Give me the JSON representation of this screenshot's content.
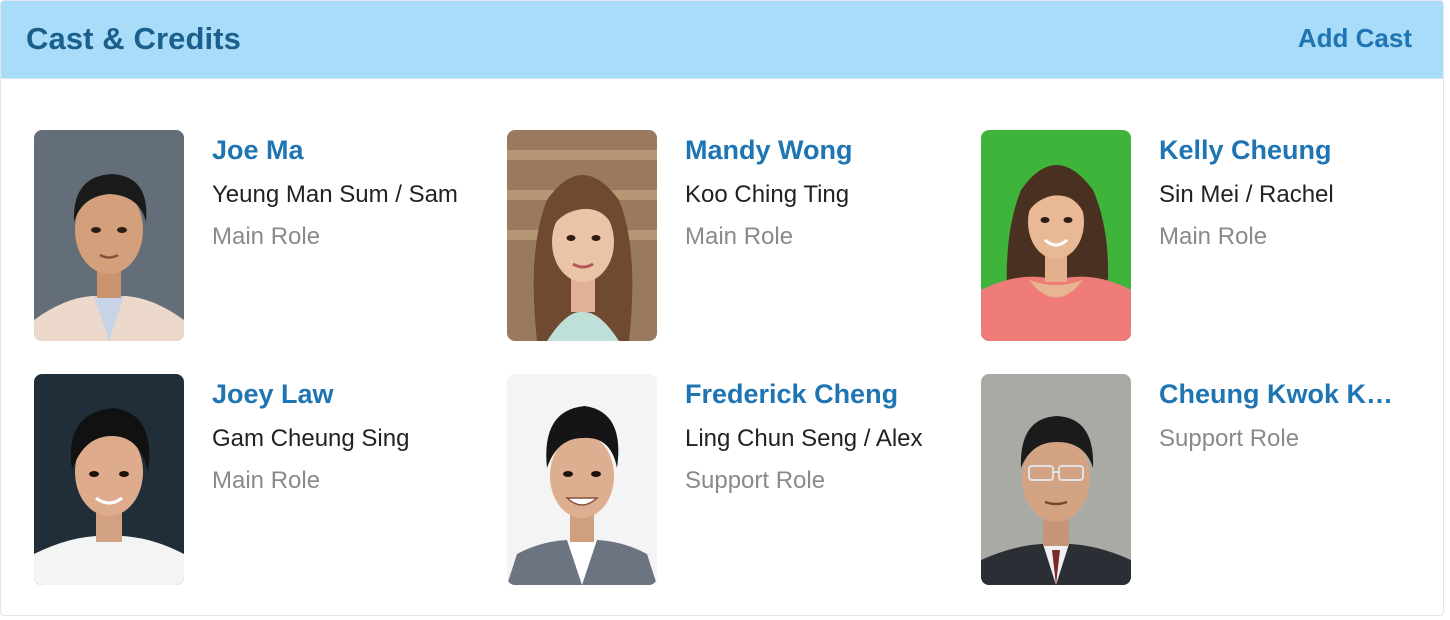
{
  "header": {
    "title": "Cast & Credits",
    "add_label": "Add Cast"
  },
  "cast": [
    {
      "name": "Joe Ma",
      "character": "Yeung Man Sum / Sam",
      "role": "Main Role",
      "photo_icon": "portrait-photo"
    },
    {
      "name": "Mandy Wong",
      "character": "Koo Ching Ting",
      "role": "Main Role",
      "photo_icon": "portrait-photo"
    },
    {
      "name": "Kelly Cheung",
      "character": "Sin Mei / Rachel",
      "role": "Main Role",
      "photo_icon": "portrait-photo"
    },
    {
      "name": "Joey Law",
      "character": "Gam Cheung Sing",
      "role": "Main Role",
      "photo_icon": "portrait-photo"
    },
    {
      "name": "Frederick Cheng",
      "character": "Ling Chun Seng / Alex",
      "role": "Support Role",
      "photo_icon": "portrait-photo"
    },
    {
      "name": "Cheung Kwok Ke...",
      "character": "",
      "role": "Support Role",
      "photo_icon": "portrait-photo"
    }
  ],
  "colors": {
    "header_bg": "#a8dcf8",
    "title": "#1b5f8c",
    "link": "#1f74b3",
    "character_text": "#222222",
    "role_text": "#8a8a8a"
  }
}
